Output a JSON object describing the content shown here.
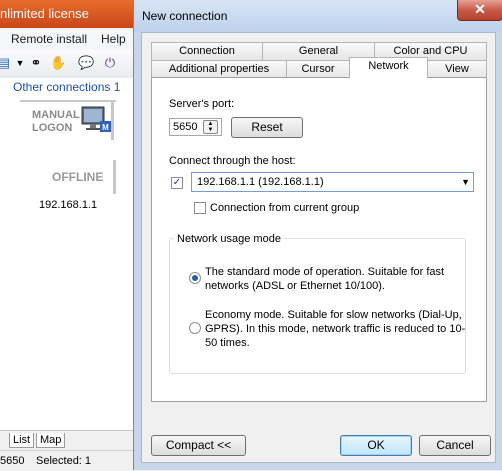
{
  "background_app": {
    "title": "nlimited license",
    "menu": [
      "Remote install",
      "Help"
    ],
    "other_connections": "Other connections 1",
    "card": {
      "status_top": "MANUAL\nLOGON",
      "status_bottom": "OFFLINE",
      "ip": "192.168.1.1"
    },
    "bottom_tabs": [
      "List",
      "Map"
    ],
    "status_bar": {
      "port": "5650",
      "selected": "Selected: 1"
    }
  },
  "dialog": {
    "title": "New connection",
    "close_label": "✕",
    "tabs_row1": [
      "Connection",
      "General",
      "Color and CPU"
    ],
    "tabs_row2": [
      "Additional properties",
      "Cursor",
      "Network",
      "View"
    ],
    "active_tab": "Network",
    "servers_port_label": "Server's port:",
    "port_value": "5650",
    "reset_label": "Reset",
    "connect_through_label": "Connect through the host:",
    "host_checked": true,
    "host_value": "192.168.1.1 (192.168.1.1)",
    "from_group_label": "Connection from current group",
    "from_group_checked": false,
    "network_mode_title": "Network usage mode",
    "mode_standard": "The standard mode of operation. Suitable for fast networks (ADSL or Ethernet 10/100).",
    "mode_economy": "Economy mode. Suitable for slow networks (Dial-Up, GPRS). In this mode, network traffic is reduced to 10-50 times.",
    "selected_mode": "standard",
    "compact_label": "Compact <<",
    "ok_label": "OK",
    "cancel_label": "Cancel"
  }
}
